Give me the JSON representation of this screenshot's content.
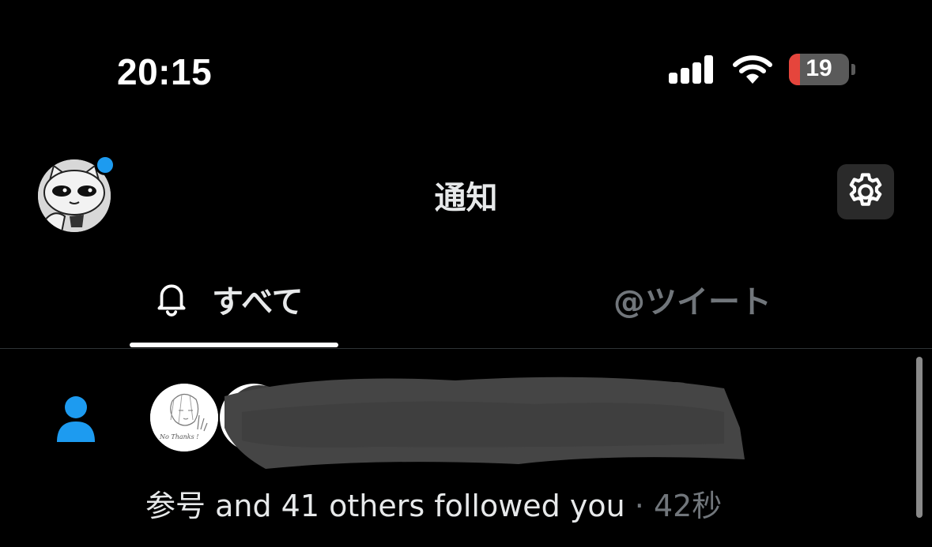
{
  "status_bar": {
    "time": "20:15",
    "signal_icon": "cellular-signal-icon",
    "wifi_icon": "wifi-icon",
    "battery_level": "19",
    "battery_color": "#e5453c"
  },
  "header": {
    "title": "通知",
    "avatar_icon": "profile-avatar",
    "settings_icon": "gear-icon"
  },
  "tabs": [
    {
      "label": "すべて",
      "icon": "bell-icon",
      "active": true
    },
    {
      "label": "@ツイート",
      "active": false
    }
  ],
  "notification": {
    "type_icon": "person-icon",
    "actor": "参号",
    "text": " and 41 others followed you",
    "separator": " · ",
    "time": "42秒"
  },
  "colors": {
    "accent": "#1d9bf0",
    "text_primary": "#e7e9ea",
    "text_secondary": "#71767b",
    "background": "#000000"
  }
}
